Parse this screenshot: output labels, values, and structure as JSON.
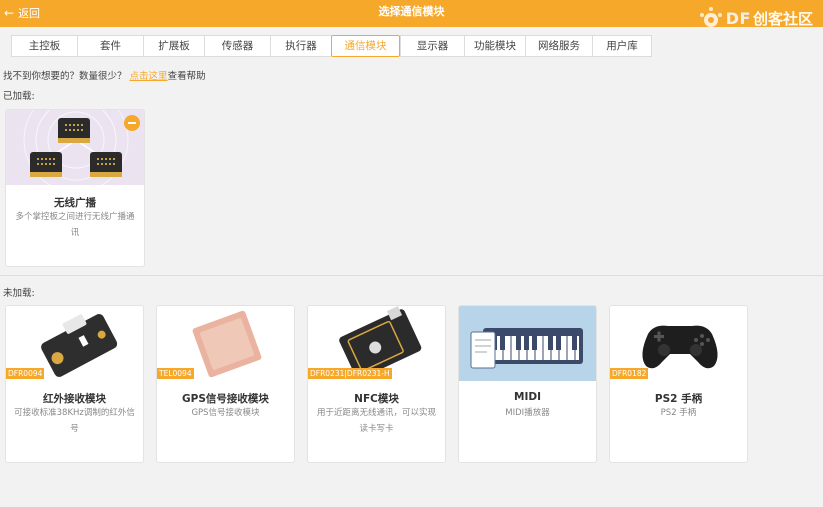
{
  "header": {
    "back_label": "返回",
    "title": "选择通信模块",
    "logo_text": "DF",
    "logo_cn": "创客社区"
  },
  "tabs": [
    {
      "label": "主控板",
      "active": false
    },
    {
      "label": "套件",
      "active": false
    },
    {
      "label": "扩展板",
      "active": false
    },
    {
      "label": "传感器",
      "active": false
    },
    {
      "label": "执行器",
      "active": false
    },
    {
      "label": "通信模块",
      "active": true
    },
    {
      "label": "显示器",
      "active": false
    },
    {
      "label": "功能模块",
      "active": false
    },
    {
      "label": "网络服务",
      "active": false
    },
    {
      "label": "用户库",
      "active": false
    }
  ],
  "help": {
    "prefix": "找不到你想要的？数量很少？",
    "link": "点击这里",
    "suffix": "查看帮助"
  },
  "loaded": {
    "label": "已加载:",
    "items": [
      {
        "name": "无线广播",
        "desc": "多个掌控板之间进行无线广播通讯"
      }
    ]
  },
  "unloaded": {
    "label": "未加载:",
    "items": [
      {
        "sku": "DFR0094",
        "name": "红外接收模块",
        "desc": "可接收标准38KHz调制的红外信号"
      },
      {
        "sku": "TEL0094",
        "name": "GPS信号接收模块",
        "desc": "GPS信号接收模块"
      },
      {
        "sku": "DFR0231|DFR0231-H",
        "name": "NFC模块",
        "desc": "用于近距离无线通讯，可以实现读卡写卡"
      },
      {
        "sku": "",
        "name": "MIDI",
        "desc": "MIDI播放器"
      },
      {
        "sku": "DFR0182",
        "name": "PS2 手柄",
        "desc": "PS2 手柄"
      }
    ]
  },
  "colors": {
    "accent": "#f6a82b",
    "background": "#f2f2f2"
  }
}
